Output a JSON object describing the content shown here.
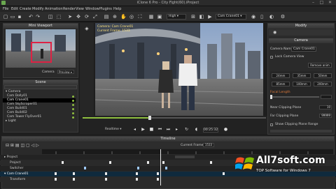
{
  "window": {
    "title": "iClone 6 Pro - City Fight(60).iProject",
    "minimize": "–",
    "maximize": "□",
    "close": "✕"
  },
  "menu": [
    "File",
    "Edit",
    "Create",
    "Modify",
    "Animation",
    "Render",
    "View",
    "Window",
    "Plugins",
    "Help"
  ],
  "toolbar": {
    "quality": "High",
    "camera": "Cam Crane01"
  },
  "mini_viewport": {
    "title": "Mini Viewport",
    "camera_label": "Camera",
    "preview_label": "Preview"
  },
  "scene": {
    "title": "Scene",
    "items": [
      {
        "label": "Camera",
        "selected": false
      },
      {
        "label": "Cam Dolly01",
        "selected": false
      },
      {
        "label": "Cam Crane01",
        "selected": true
      },
      {
        "label": "Cam SkyScraper01",
        "selected": false
      },
      {
        "label": "Cam Build01",
        "selected": false
      },
      {
        "label": "Cam Build02",
        "selected": false
      },
      {
        "label": "Cam Tower FlyOver01",
        "selected": false
      },
      {
        "label": "Light",
        "selected": false
      }
    ]
  },
  "viewport": {
    "overlay_line1": "Camera: Cam Crane01",
    "overlay_line2": "Current Frame: 1533"
  },
  "playback": {
    "mode": "Realtime",
    "timecode": "00:25:32"
  },
  "modify": {
    "title": "Modify",
    "section": "Camera",
    "camera_name_label": "Camera Name",
    "camera_name_value": "Cam Crane01",
    "lock_label": "Lock Camera View",
    "remove_anim": "Remove anim",
    "lens": [
      "24mm",
      "35mm",
      "50mm",
      "85mm",
      "100mm",
      "200mm"
    ],
    "focal_label": "Focal Length",
    "near_label": "Near Clipping Plane",
    "far_label": "Far Clipping Plane",
    "show_clip": "Show Clipping Plane Range",
    "near_value": "10",
    "far_value": "99999"
  },
  "timeline": {
    "title": "Timeline",
    "current_frame_label": "Current Frame",
    "current_frame": "1533",
    "rows": [
      "Project",
      "Project",
      "Switcher",
      "Cam Crane01",
      "Transform"
    ]
  },
  "watermark": {
    "line1": "All7soft.com",
    "line2": "TOP Software for Windows 7"
  }
}
